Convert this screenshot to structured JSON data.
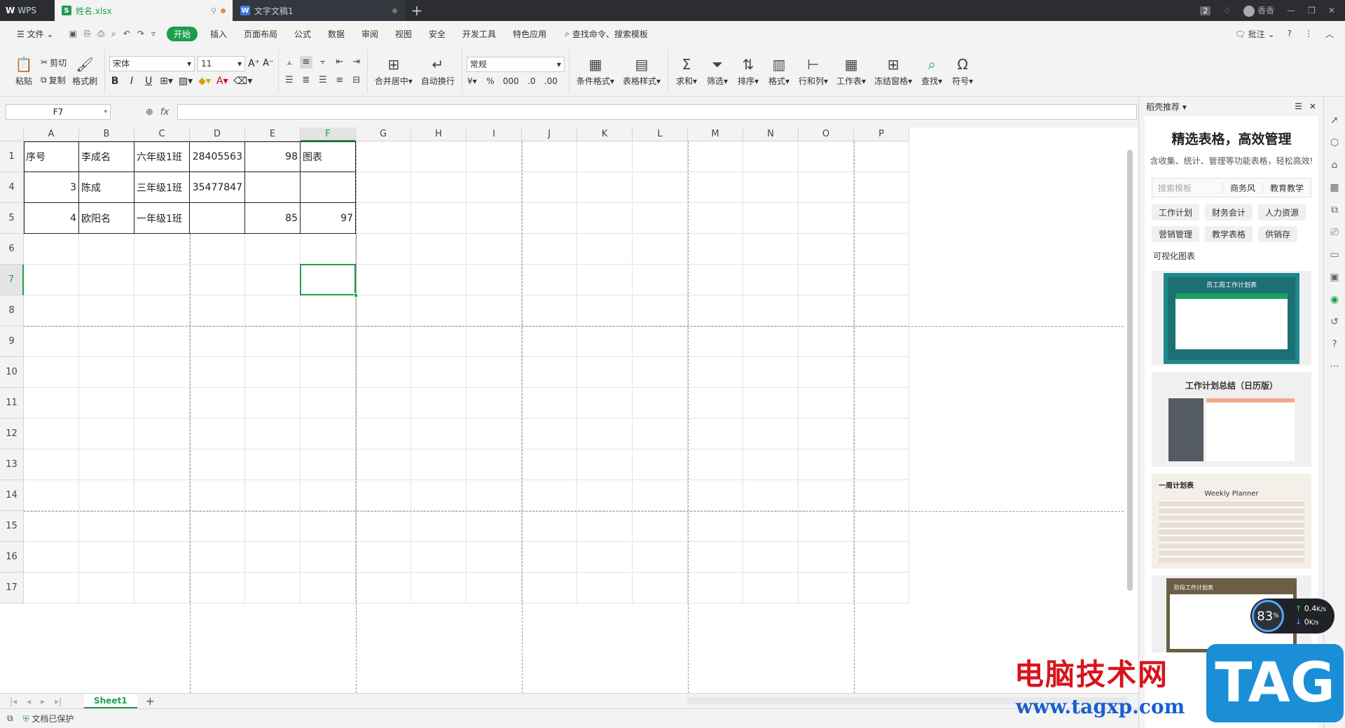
{
  "titlebar": {
    "app": "WPS",
    "tabs": [
      {
        "label": "姓名.xlsx",
        "type": "sheet"
      },
      {
        "label": "文字文稿1",
        "type": "doc"
      }
    ],
    "badge": "2",
    "user": "香香"
  },
  "menubar": {
    "file": "文件",
    "items": [
      "开始",
      "插入",
      "页面布局",
      "公式",
      "数据",
      "审阅",
      "视图",
      "安全",
      "开发工具",
      "特色应用"
    ],
    "search": "查找命令、搜索模板",
    "comment": "批注"
  },
  "ribbon": {
    "paste": "粘贴",
    "cut": "剪切",
    "copy": "复制",
    "format_painter": "格式刷",
    "font_name": "宋体",
    "font_size": "11",
    "merge": "合并居中",
    "wrap": "自动换行",
    "number_format": "常规",
    "cond_format": "条件格式",
    "table_style": "表格样式",
    "sum": "求和",
    "filter": "筛选",
    "sort": "排序",
    "format": "格式",
    "rowcol": "行和列",
    "worksheet": "工作表",
    "freeze": "冻结窗格",
    "find": "查找",
    "symbol": "符号"
  },
  "formula": {
    "namebox": "F7",
    "value": ""
  },
  "grid": {
    "columns": [
      "A",
      "B",
      "C",
      "D",
      "E",
      "F",
      "G",
      "H",
      "I",
      "J",
      "K",
      "L",
      "M",
      "N",
      "O",
      "P"
    ],
    "active_col": "F",
    "rows": [
      "1",
      "4",
      "5",
      "6",
      "7",
      "8",
      "9",
      "10",
      "11",
      "12",
      "13",
      "14",
      "15",
      "16",
      "17"
    ],
    "active_row": "7",
    "data": [
      [
        "序号",
        "李成名",
        "六年级1班",
        "28405563",
        "98",
        "图表"
      ],
      [
        "3",
        "陈成",
        "三年级1班",
        "35477847",
        "",
        ""
      ],
      [
        "4",
        "欧阳名",
        "一年级1班",
        "",
        "85",
        "97"
      ]
    ]
  },
  "sheets": {
    "tabs": [
      "Sheet1"
    ],
    "status": "文档已保护"
  },
  "panel": {
    "header": "稻壳推荐",
    "title": "精选表格，高效管理",
    "subtitle": "含收集、统计、管理等功能表格，轻松高效!",
    "search_placeholder": "搜索模板",
    "search_tags": [
      "商务风",
      "教育教学"
    ],
    "categories": [
      "工作计划",
      "财务会计",
      "人力资源",
      "营销管理",
      "教学表格",
      "供销存",
      "可视化图表"
    ],
    "templates": [
      {
        "title": "员工周工作计划表"
      },
      {
        "title": "工作计划总结（日历版）"
      },
      {
        "title": "一周计划表",
        "subtitle": "Weekly Planner"
      },
      {
        "title": "阶段工作计划表"
      }
    ]
  },
  "meter": {
    "percent": "83",
    "up": "0.4",
    "down": "0",
    "unit": "K/s"
  },
  "watermark": {
    "cn": "电脑技术网",
    "url": "www.tagxp.com",
    "tag": "TAG"
  },
  "colors": {
    "accent": "#1e9e4d",
    "titlebar": "#2b2d33"
  }
}
